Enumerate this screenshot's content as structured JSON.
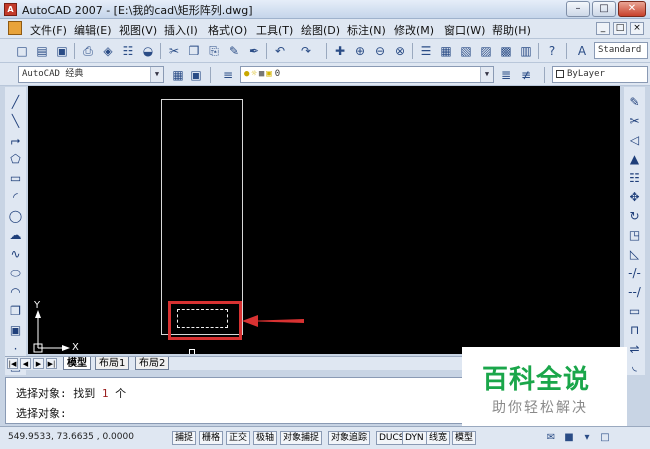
{
  "window": {
    "title": "AutoCAD 2007 - [E:\\我的cad\\矩形阵列.dwg]",
    "app_icon": "autocad-logo-icon",
    "controls": [
      "minimize-icon",
      "maximize-icon",
      "close-icon"
    ]
  },
  "menubar": {
    "items": [
      "文件(F)",
      "编辑(E)",
      "视图(V)",
      "插入(I)",
      "格式(O)",
      "工具(T)",
      "绘图(D)",
      "标注(N)",
      "修改(M)",
      "窗口(W)",
      "帮助(H)"
    ],
    "mdi_controls": [
      "_",
      "□",
      "×"
    ]
  },
  "toolbar_standard": {
    "textstyle_combo": "Standard"
  },
  "toolbar_layers": {
    "workspace_combo": "AutoCAD 经典",
    "layer_combo": "0",
    "color_combo": "ByLayer"
  },
  "drawing": {
    "background": "#000000",
    "ucs": {
      "y_label": "Y",
      "x_label": "X"
    },
    "highlight_color": "#d83232"
  },
  "layout_tabs": {
    "nav": [
      "|◀",
      "◀",
      "▶",
      "▶|"
    ],
    "tabs": [
      "模型",
      "布局1",
      "布局2"
    ],
    "active": "模型"
  },
  "command": {
    "line1_prefix": "选择对象: 找到 ",
    "line1_count": "1",
    "line1_suffix": " 个",
    "line2": "选择对象:"
  },
  "statusbar": {
    "coordinates": "549.9533,  73.6635 , 0.0000",
    "toggles": [
      "捕捉",
      "栅格",
      "正交",
      "极轴",
      "对象捕捉",
      "对象追踪",
      "DUCS",
      "DYN",
      "线宽",
      "模型"
    ]
  },
  "watermark": {
    "title": "百科全说",
    "subtitle": "助你轻松解决"
  }
}
